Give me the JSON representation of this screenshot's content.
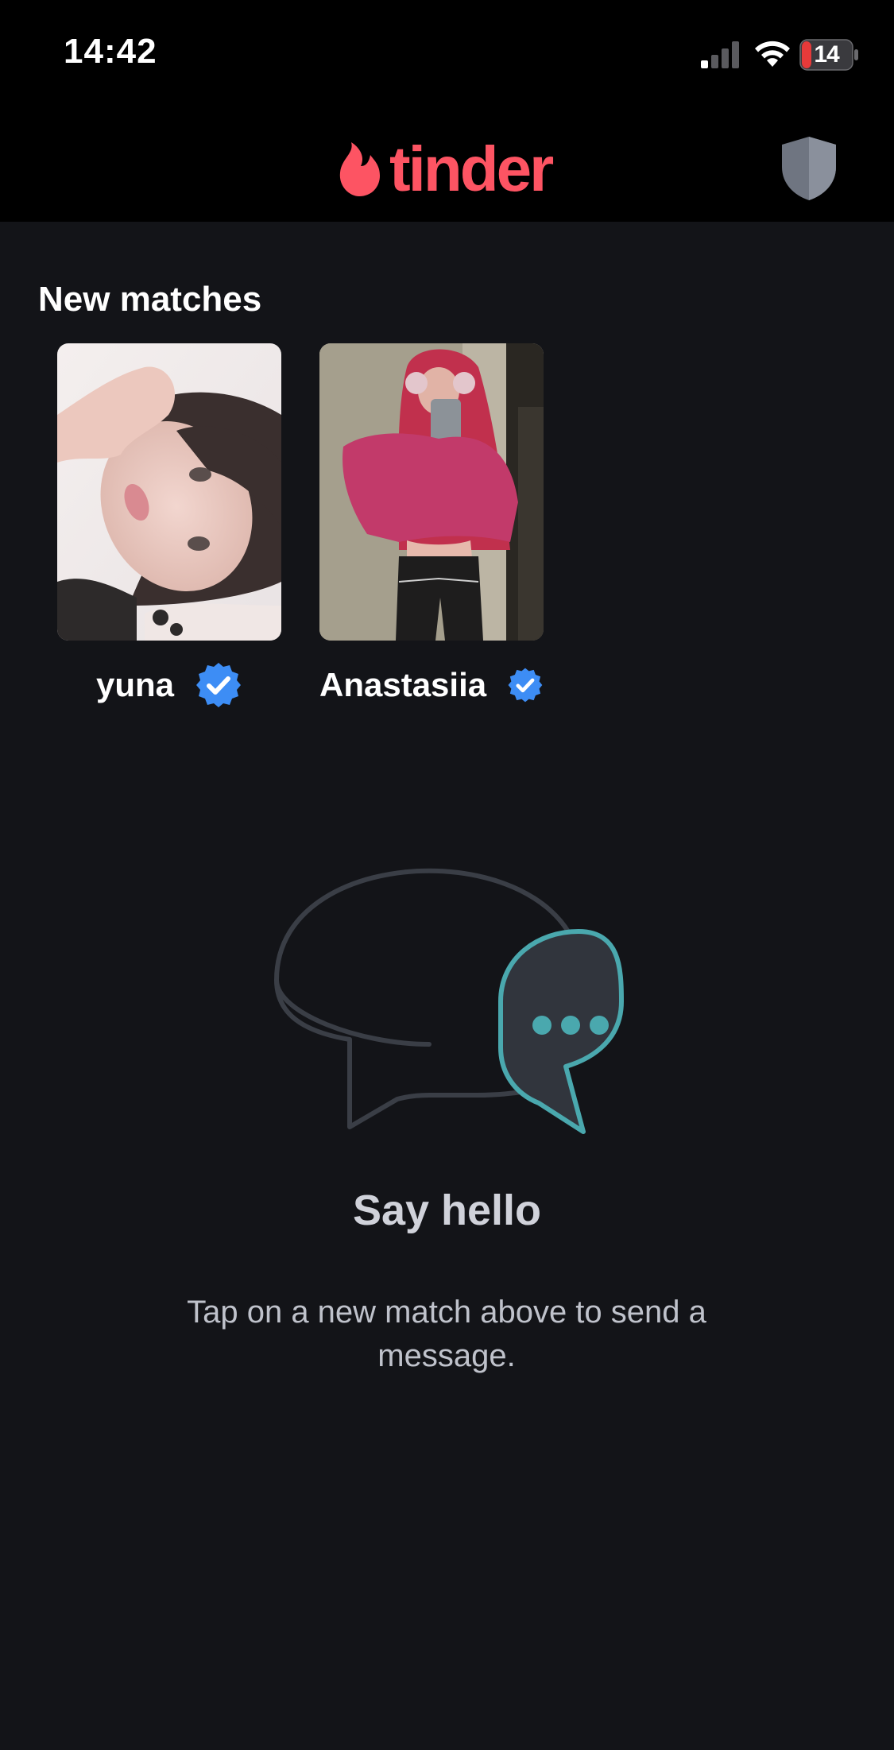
{
  "status_bar": {
    "time": "14:42",
    "battery": "14",
    "icons": [
      "signal-icon",
      "wifi-icon",
      "battery-charging-icon"
    ]
  },
  "header": {
    "logo_text": "tinder",
    "logo_icon": "flame-icon",
    "right_icon": "shield-icon"
  },
  "new_matches": {
    "title": "New matches",
    "items": [
      {
        "name": "yuna",
        "verified": true
      },
      {
        "name": "Anastasiia",
        "verified": true
      }
    ]
  },
  "empty_state": {
    "icon": "chat-bubbles-icon",
    "title": "Say hello",
    "message": "Tap on a new match above to send a message."
  },
  "colors": {
    "brand": "#fd5463",
    "background": "#131418",
    "header": "#000000",
    "verified": "#3d8df5",
    "chat_accent": "#4aa8ae"
  }
}
